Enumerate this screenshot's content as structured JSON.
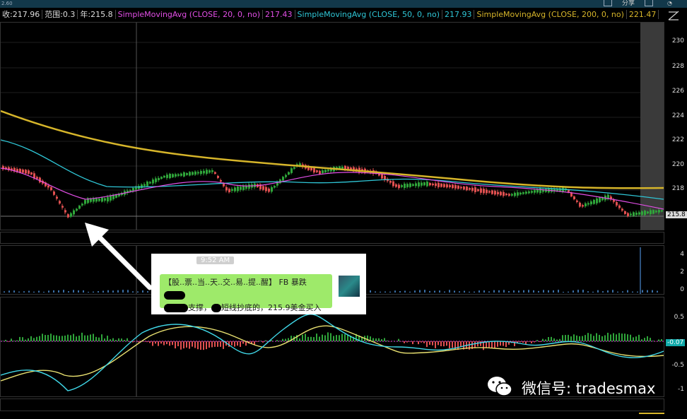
{
  "topbar": {
    "left_text": "2.60",
    "share_label": "分享"
  },
  "legend": {
    "close": "收:217.96",
    "range": "范围:0.3",
    "year": "年:215.8",
    "sma20_label": "SimpleMovingAvg (CLOSE, 20, 0, no)",
    "sma20_value": "217.43",
    "sma50_label": "SimpleMovingAvg (CLOSE, 50, 0, no)",
    "sma50_value": "217.93",
    "sma200_label": "SimpleMovingAvg (CLOSE, 200, 0, no)",
    "sma200_value": "221.47"
  },
  "price_scale": [
    "230",
    "228",
    "226",
    "224",
    "222",
    "220",
    "218"
  ],
  "price_current": "215.8",
  "volume_scale": [
    "4",
    "2",
    "0"
  ],
  "macd_scale": [
    "0.5",
    "-0.07",
    "-0.5",
    "-1"
  ],
  "notification": {
    "time": "9:52 AM",
    "line1": "【股..票..当..天..交..易..提..醒】 FB 暴跌",
    "line2_a": "支撑，",
    "line2_b": "短线抄底的，215.9美金买入"
  },
  "watermark": "微信号: tradesmax",
  "colors": {
    "sma20": "#e24ee6",
    "sma50": "#2fc6d6",
    "sma200": "#d6b52a",
    "up": "#2fa53a",
    "down": "#e05050"
  }
}
